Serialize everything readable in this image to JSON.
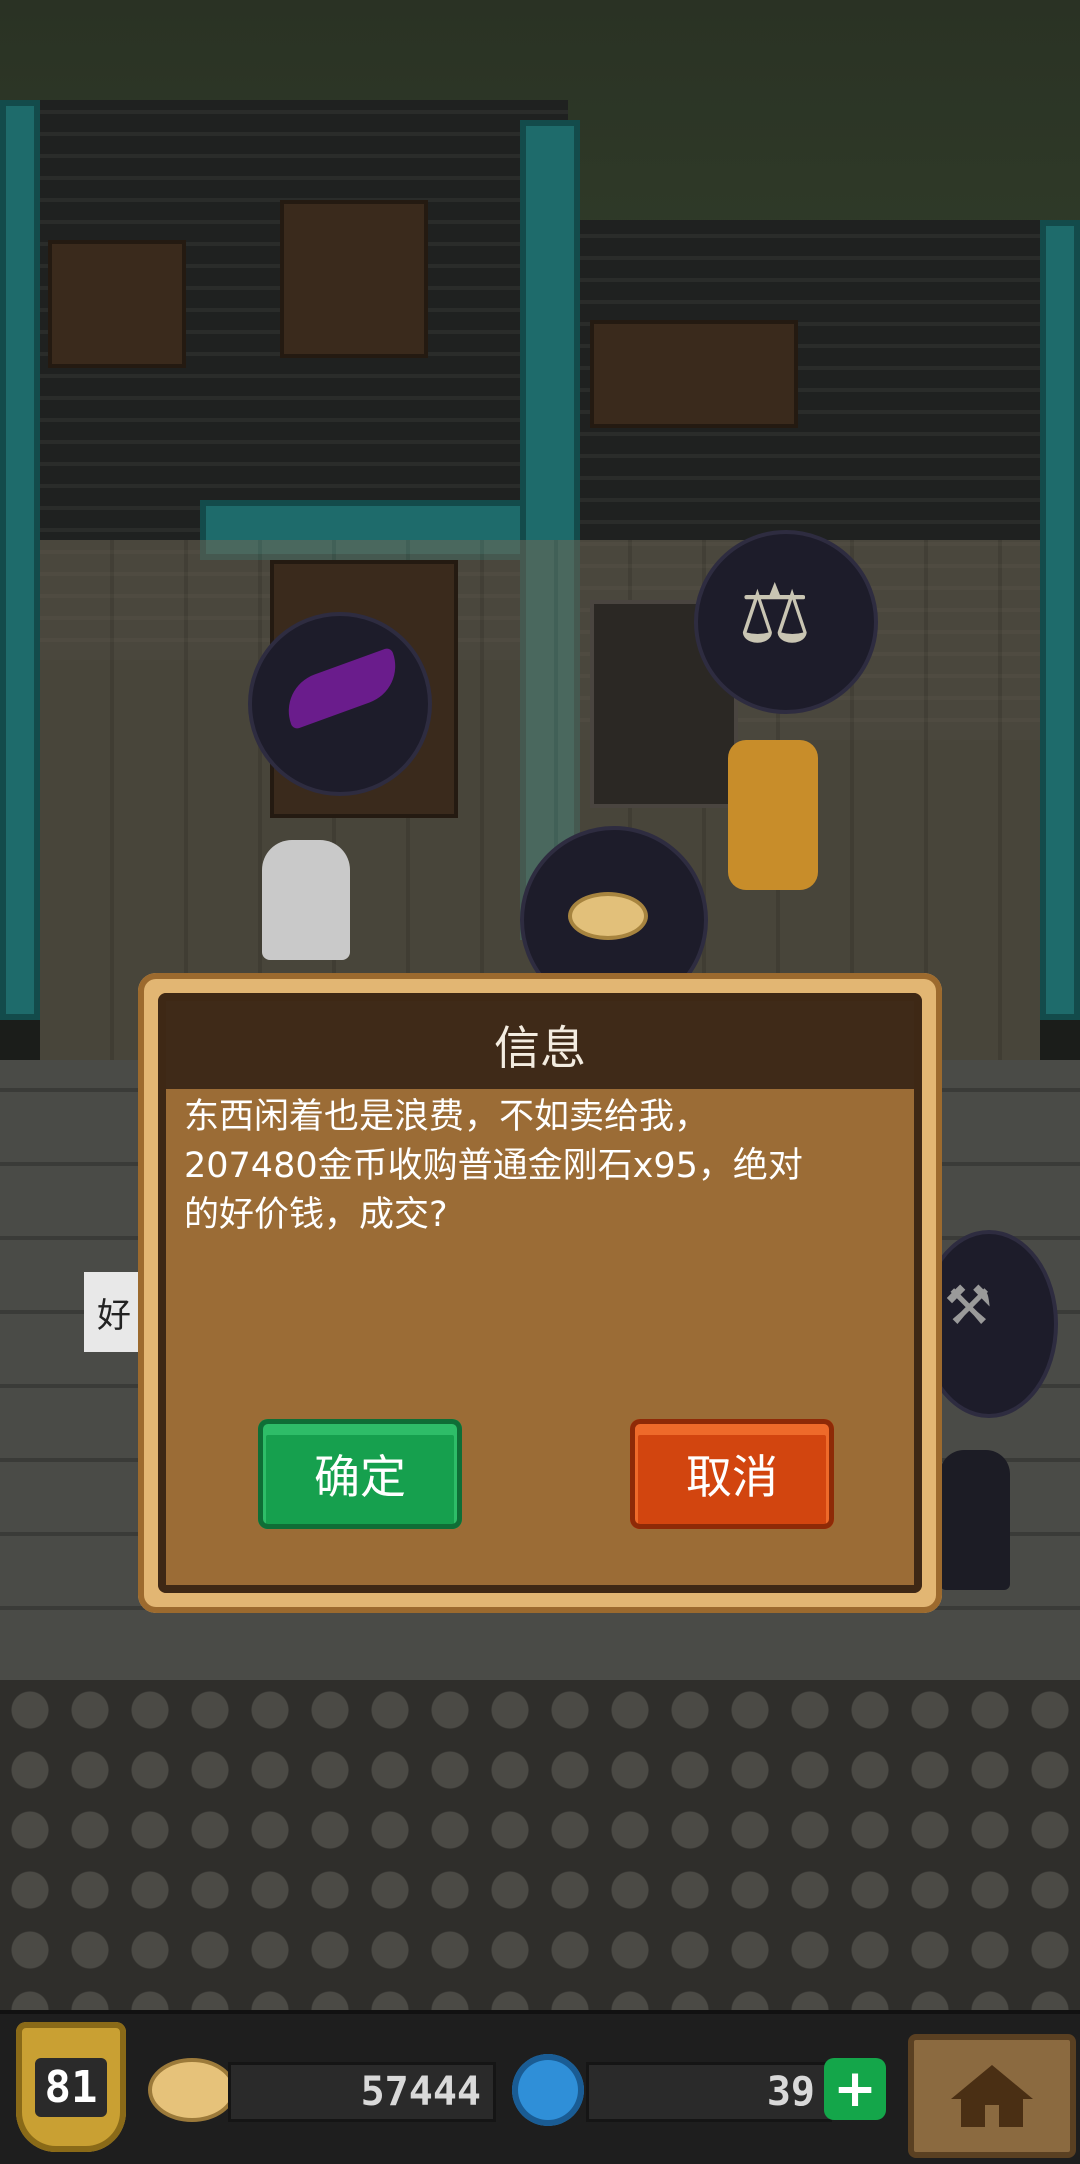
{
  "dialog": {
    "title": "信息",
    "message": "东西闲着也是浪费，不如卖给我，\n207480金币收购普通金刚石x95，绝对\n的好价钱，成交?",
    "confirm_label": "确定",
    "cancel_label": "取消"
  },
  "scene": {
    "side_text": "好"
  },
  "hud": {
    "level": "81",
    "gold": "57444",
    "gems": "39",
    "plus_symbol": "+"
  },
  "icons": {
    "level_badge": "shield-badge-icon",
    "gold": "gold-coin-icon",
    "gems": "blue-gem-icon",
    "plus": "plus-icon",
    "home": "home-icon",
    "bubble_1": "feather-icon",
    "bubble_2": "scales-icon",
    "bubble_3": "coin-icon",
    "bubble_4": "hammer-icon"
  },
  "colors": {
    "confirm": "#16a04e",
    "cancel": "#d2450f",
    "dialog_frame": "#e2b673",
    "dialog_body": "#9b6c36",
    "dialog_header": "#3f2a18"
  }
}
